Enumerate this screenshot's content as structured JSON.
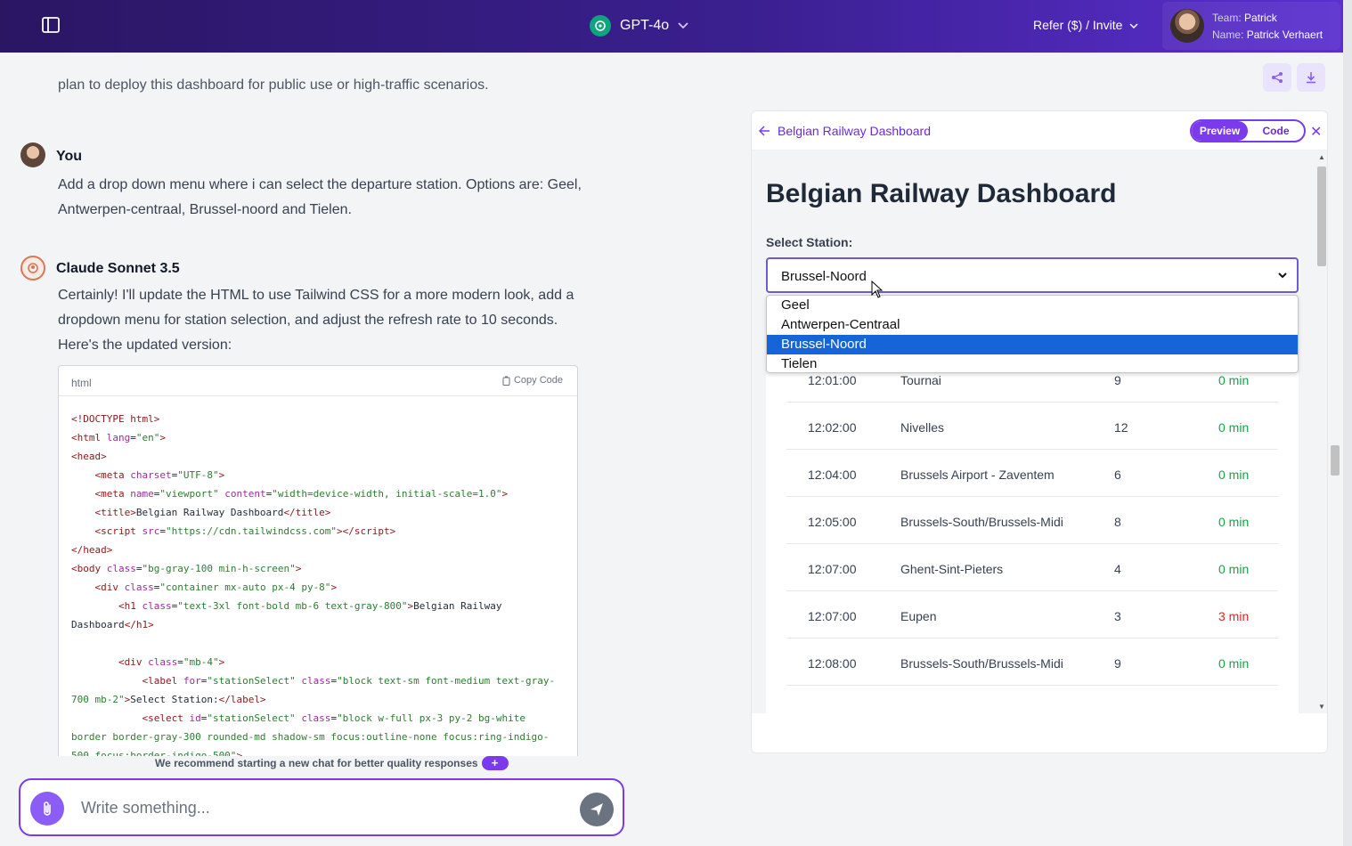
{
  "header": {
    "model_name": "GPT-4o",
    "refer_label": "Refer ($) / Invite",
    "team_key": "Team:",
    "team_value": "Patrick",
    "name_key": "Name:",
    "name_value": "Patrick Verhaert",
    "colors": {
      "gradient_start": "#2a1663",
      "gradient_end": "#5b2fd0"
    }
  },
  "chat": {
    "faded_text": "plan to deploy this dashboard for public use or high-traffic scenarios.",
    "messages": [
      {
        "author": "You",
        "text": "Add a drop down menu where i can select the departure station. Options are: Geel, Antwerpen-centraal, Brussel-noord and Tielen."
      },
      {
        "author": "Claude Sonnet 3.5",
        "text": "Certainly! I'll update the HTML to use Tailwind CSS for a more modern look, add a dropdown menu for station selection, and adjust the refresh rate to 10 seconds. Here's the updated version:"
      }
    ],
    "code_block": {
      "lang": "html",
      "copy_label": "Copy Code"
    },
    "recommend_text": "We recommend starting a new chat for better quality responses",
    "recommend_plus": "+",
    "composer_placeholder": "Write something..."
  },
  "artifact": {
    "title": "Belgian Railway Dashboard",
    "toggle": {
      "preview": "Preview",
      "code": "Code"
    },
    "close_glyph": "✕",
    "preview": {
      "heading": "Belgian Railway Dashboard",
      "select_label": "Select Station:",
      "selected_station": "Brussel-Noord",
      "options": [
        "Geel",
        "Antwerpen-Centraal",
        "Brussel-Noord",
        "Tielen"
      ],
      "departures": [
        {
          "time": "12:01:00",
          "destination": "Tournai",
          "platform": "9",
          "delay": "0 min",
          "late": false
        },
        {
          "time": "12:02:00",
          "destination": "Nivelles",
          "platform": "12",
          "delay": "0 min",
          "late": false
        },
        {
          "time": "12:04:00",
          "destination": "Brussels Airport - Zaventem",
          "platform": "6",
          "delay": "0 min",
          "late": false
        },
        {
          "time": "12:05:00",
          "destination": "Brussels-South/Brussels-Midi",
          "platform": "8",
          "delay": "0 min",
          "late": false
        },
        {
          "time": "12:07:00",
          "destination": "Ghent-Sint-Pieters",
          "platform": "4",
          "delay": "0 min",
          "late": false
        },
        {
          "time": "12:07:00",
          "destination": "Eupen",
          "platform": "3",
          "delay": "3 min",
          "late": true
        },
        {
          "time": "12:08:00",
          "destination": "Brussels-South/Brussels-Midi",
          "platform": "9",
          "delay": "0 min",
          "late": false
        }
      ]
    }
  }
}
